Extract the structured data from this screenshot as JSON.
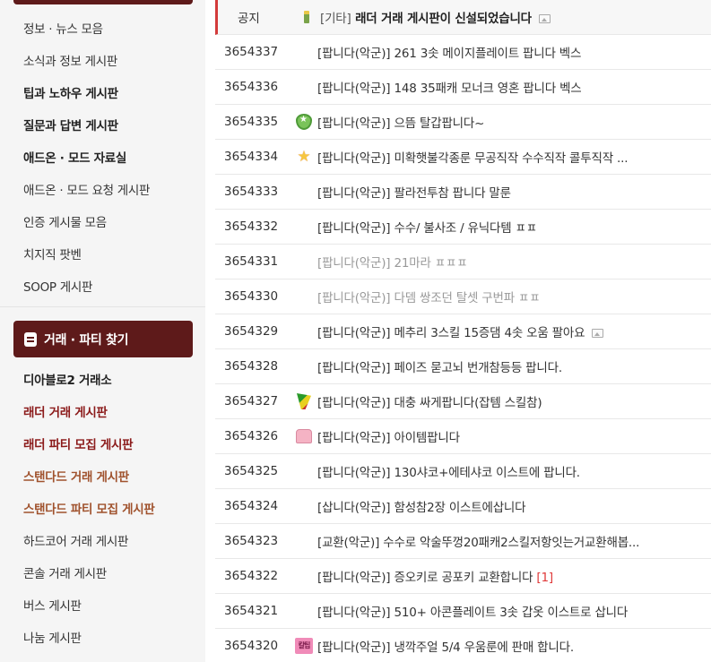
{
  "sidebar": {
    "info_items": [
      {
        "label": "정보 · 뉴스 모음",
        "style": "normal"
      },
      {
        "label": "소식과 정보 게시판",
        "style": "normal"
      },
      {
        "label": "팁과 노하우 게시판",
        "style": "bold"
      },
      {
        "label": "질문과 답변 게시판",
        "style": "bold"
      },
      {
        "label": "애드온 · 모드 자료실",
        "style": "bold"
      },
      {
        "label": "애드온 · 모드 요청 게시판",
        "style": "normal"
      },
      {
        "label": "인증 게시물 모음",
        "style": "normal"
      },
      {
        "label": "치지직 팟벤",
        "style": "normal"
      },
      {
        "label": "SOOP 게시판",
        "style": "normal"
      }
    ],
    "trade_section_title": "거래 · 파티 찾기",
    "trade_items": [
      {
        "label": "디아블로2 거래소",
        "style": "bold"
      },
      {
        "label": "래더 거래 게시판",
        "style": "red"
      },
      {
        "label": "래더 파티 모집 게시판",
        "style": "red"
      },
      {
        "label": "스탠다드 거래 게시판",
        "style": "brown"
      },
      {
        "label": "스탠다드 파티 모집 게시판",
        "style": "brown"
      },
      {
        "label": "하드코어 거래 게시판",
        "style": "normal"
      },
      {
        "label": "콘솔 거래 게시판",
        "style": "normal"
      },
      {
        "label": "버스 게시판",
        "style": "normal"
      },
      {
        "label": "나눔 게시판",
        "style": "normal"
      }
    ]
  },
  "board": {
    "notice": {
      "num": "공지",
      "icon": "notice-rank-icon",
      "category": "[기타]",
      "title": "래더 거래 게시판이 신설되었습니다",
      "has_image": true
    },
    "posts": [
      {
        "num": "3654337",
        "icon": "",
        "category": "[팝니다(악군)]",
        "title": "261 3솟 메이지플레이트 팝니다 벡스",
        "grey": false,
        "has_image": false,
        "comments": ""
      },
      {
        "num": "3654336",
        "icon": "",
        "category": "[팝니다(악군)]",
        "title": "148 35패캐 모너크 영혼 팝니다 벡스",
        "grey": false,
        "has_image": false,
        "comments": ""
      },
      {
        "num": "3654335",
        "icon": "shield-rank-icon",
        "category": "[팝니다(악군)]",
        "title": "으뜸 탈갑팝니다~",
        "grey": false,
        "has_image": false,
        "comments": ""
      },
      {
        "num": "3654334",
        "icon": "star-rank-icon",
        "category": "[팝니다(악군)]",
        "title": "미확햇불각종룬 무공직작 수수직작 콜투직작 ...",
        "grey": false,
        "has_image": false,
        "comments": ""
      },
      {
        "num": "3654333",
        "icon": "",
        "category": "[팝니다(악군)]",
        "title": "팔라전투참 팝니다 말룬",
        "grey": false,
        "has_image": false,
        "comments": ""
      },
      {
        "num": "3654332",
        "icon": "",
        "category": "[팝니다(악군)]",
        "title": "수수/ 불사조 / 유닉다템 ㅍㅍ",
        "grey": false,
        "has_image": false,
        "comments": ""
      },
      {
        "num": "3654331",
        "icon": "",
        "category": "[팝니다(악군)]",
        "title": "21마라 ㅍㅍㅍ",
        "grey": true,
        "has_image": false,
        "comments": ""
      },
      {
        "num": "3654330",
        "icon": "",
        "category": "[팝니다(악군)]",
        "title": "다뎀 쌍조던 탈셋 구번파 ㅍㅍ",
        "grey": true,
        "has_image": false,
        "comments": ""
      },
      {
        "num": "3654329",
        "icon": "",
        "category": "[팝니다(악군)]",
        "title": "메추리 3스킬 15증댐 4솟 오움 팔아요",
        "grey": false,
        "has_image": true,
        "comments": ""
      },
      {
        "num": "3654328",
        "icon": "",
        "category": "[팝니다(악군)]",
        "title": "페이즈 묻고뇌 번개참등등 팝니다.",
        "grey": false,
        "has_image": false,
        "comments": ""
      },
      {
        "num": "3654327",
        "icon": "flag-rank-icon",
        "category": "[팝니다(악군)]",
        "title": "대충 싸게팝니다(잡템 스킬참)",
        "grey": false,
        "has_image": false,
        "comments": ""
      },
      {
        "num": "3654326",
        "icon": "cake-rank-icon",
        "category": "[팝니다(악군)]",
        "title": "아이템팝니다",
        "grey": false,
        "has_image": false,
        "comments": ""
      },
      {
        "num": "3654325",
        "icon": "",
        "category": "[팝니다(악군)]",
        "title": "130샤코+에테샤코 이스트에 팝니다.",
        "grey": false,
        "has_image": false,
        "comments": ""
      },
      {
        "num": "3654324",
        "icon": "",
        "category": "[삽니다(악군)]",
        "title": "함성참2장 이스트에삽니다",
        "grey": false,
        "has_image": false,
        "comments": ""
      },
      {
        "num": "3654323",
        "icon": "",
        "category": "[교환(악군)]",
        "title": "수수로 악술뚜껑20패캐2스킬저항잇는거교환해봅...",
        "grey": false,
        "has_image": false,
        "comments": ""
      },
      {
        "num": "3654322",
        "icon": "",
        "category": "[팝니다(악군)]",
        "title": "증오키로 공포키 교환합니다",
        "grey": false,
        "has_image": false,
        "comments": "[1]"
      },
      {
        "num": "3654321",
        "icon": "",
        "category": "[팝니다(악군)]",
        "title": "510+ 아콘플레이트 3솟 갑옷 이스트로 삽니다",
        "grey": false,
        "has_image": false,
        "comments": ""
      },
      {
        "num": "3654320",
        "icon": "badge-rank-icon",
        "category": "[팝니다(악군)]",
        "title": "냉깍주얼 5/4 우움룬에 판매 합니다.",
        "grey": false,
        "has_image": false,
        "comments": ""
      }
    ]
  }
}
